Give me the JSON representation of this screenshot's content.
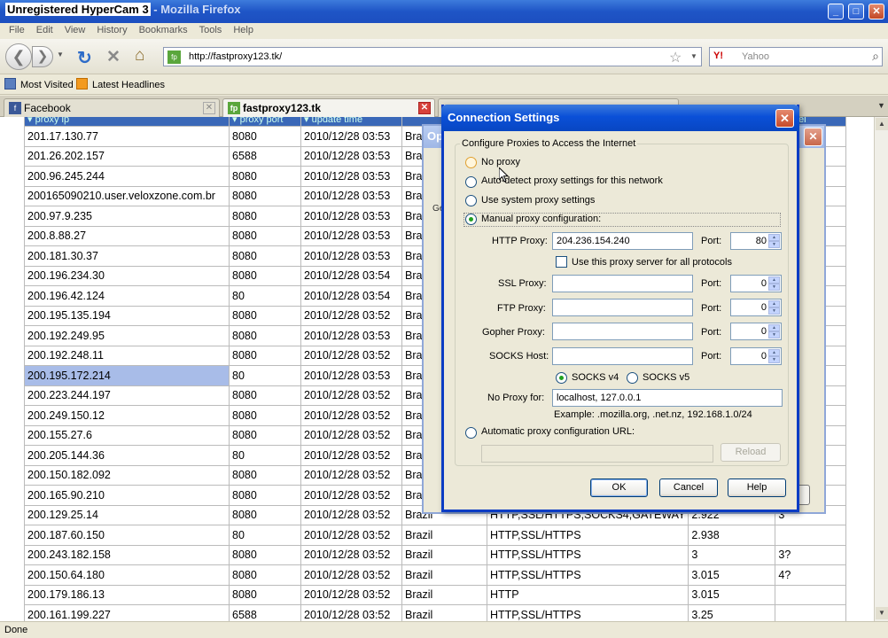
{
  "window": {
    "title_watermark": "Unregistered HyperCam 3",
    "title_rest": " - Mozilla Firefox",
    "controls": [
      "_",
      "□",
      "✕"
    ]
  },
  "menu": [
    "File",
    "Edit",
    "View",
    "History",
    "Bookmarks",
    "Tools",
    "Help"
  ],
  "nav": {
    "url": "http://fastproxy123.tk/",
    "search_engine": "Y!",
    "search_placeholder": "Yahoo"
  },
  "bookmarks": [
    "Most Visited",
    "Latest Headlines"
  ],
  "tabs": [
    {
      "label": "Facebook",
      "active": false
    },
    {
      "label": "fastproxy123.tk",
      "active": true
    },
    {
      "label": "",
      "active": false
    }
  ],
  "table": {
    "headers": [
      "▾ proxy ip",
      "▾ proxy port",
      "▾ update time",
      "",
      "",
      "",
      "▾ level"
    ],
    "rows": [
      [
        "201.17.130.77",
        "8080",
        "2010/12/28 03:53",
        "Brazil",
        "",
        "",
        ""
      ],
      [
        "201.26.202.157",
        "6588",
        "2010/12/28 03:53",
        "Brazil",
        "",
        "",
        ""
      ],
      [
        "200.96.245.244",
        "8080",
        "2010/12/28 03:53",
        "Brazil",
        "",
        "",
        ""
      ],
      [
        "200165090210.user.veloxzone.com.br",
        "8080",
        "2010/12/28 03:53",
        "Brazil",
        "",
        "",
        ""
      ],
      [
        "200.97.9.235",
        "8080",
        "2010/12/28 03:53",
        "Brazil",
        "",
        "",
        ""
      ],
      [
        "200.8.88.27",
        "8080",
        "2010/12/28 03:53",
        "Brazil",
        "",
        "",
        ""
      ],
      [
        "200.181.30.37",
        "8080",
        "2010/12/28 03:53",
        "Brazil",
        "",
        "",
        ""
      ],
      [
        "200.196.234.30",
        "8080",
        "2010/12/28 03:54",
        "Brazil",
        "",
        "",
        ""
      ],
      [
        "200.196.42.124",
        "80",
        "2010/12/28 03:54",
        "Brazil",
        "",
        "",
        ""
      ],
      [
        "200.195.135.194",
        "8080",
        "2010/12/28 03:52",
        "Brazil",
        "",
        "",
        ""
      ],
      [
        "200.192.249.95",
        "8080",
        "2010/12/28 03:53",
        "Brazil",
        "",
        "",
        ""
      ],
      [
        "200.192.248.11",
        "8080",
        "2010/12/28 03:52",
        "Brazil",
        "",
        "",
        ""
      ],
      [
        "200.195.172.214",
        "80",
        "2010/12/28 03:53",
        "Brazil",
        "",
        "",
        ""
      ],
      [
        "200.223.244.197",
        "8080",
        "2010/12/28 03:52",
        "Brazil",
        "",
        "",
        ""
      ],
      [
        "200.249.150.12",
        "8080",
        "2010/12/28 03:52",
        "Brazil",
        "",
        "",
        ""
      ],
      [
        "200.155.27.6",
        "8080",
        "2010/12/28 03:52",
        "Brazil",
        "",
        "",
        ""
      ],
      [
        "200.205.144.36",
        "80",
        "2010/12/28 03:52",
        "Brazil",
        "",
        "",
        ""
      ],
      [
        "200.150.182.092",
        "8080",
        "2010/12/28 03:52",
        "Brazil",
        "",
        "",
        ""
      ],
      [
        "200.165.90.210",
        "8080",
        "2010/12/28 03:52",
        "Brazil",
        "",
        "",
        ""
      ],
      [
        "200.129.25.14",
        "8080",
        "2010/12/28 03:52",
        "Brazil",
        "HTTP,SSL/HTTPS,SOCKS4,GATEWAY",
        "2.922",
        "3"
      ],
      [
        "200.187.60.150",
        "80",
        "2010/12/28 03:52",
        "Brazil",
        "HTTP,SSL/HTTPS",
        "2.938",
        ""
      ],
      [
        "200.243.182.158",
        "8080",
        "2010/12/28 03:52",
        "Brazil",
        "HTTP,SSL/HTTPS",
        "3",
        "3?"
      ],
      [
        "200.150.64.180",
        "8080",
        "2010/12/28 03:52",
        "Brazil",
        "HTTP,SSL/HTTPS",
        "3.015",
        "4?"
      ],
      [
        "200.179.186.13",
        "8080",
        "2010/12/28 03:52",
        "Brazil",
        "HTTP",
        "3.015",
        ""
      ],
      [
        "200.161.199.227",
        "6588",
        "2010/12/28 03:52",
        "Brazil",
        "HTTP,SSL/HTTPS",
        "3.25",
        ""
      ]
    ],
    "selected_row": 12
  },
  "status": "Done",
  "options_dialog": {
    "title": "Op",
    "tab_fragment": "Ge"
  },
  "conn": {
    "title": "Connection Settings",
    "group_label": "Configure Proxies to Access the Internet",
    "opt_no_proxy": "No proxy",
    "opt_auto_detect": "Auto-detect proxy settings for this network",
    "opt_system": "Use system proxy settings",
    "opt_manual": "Manual proxy configuration:",
    "http_label": "HTTP Proxy:",
    "http_value": "204.236.154.240",
    "port_label": "Port:",
    "http_port": "80",
    "same_proxy_label": "Use this proxy server for all protocols",
    "ssl_label": "SSL Proxy:",
    "ssl_port": "0",
    "ftp_label": "FTP Proxy:",
    "ftp_port": "0",
    "gopher_label": "Gopher Proxy:",
    "gopher_port": "0",
    "socks_label": "SOCKS Host:",
    "socks_port": "0",
    "socks_v4": "SOCKS v4",
    "socks_v5": "SOCKS v5",
    "no_proxy_label": "No Proxy for:",
    "no_proxy_value": "localhost, 127.0.0.1",
    "example": "Example: .mozilla.org, .net.nz, 192.168.1.0/24",
    "opt_auto_url": "Automatic proxy configuration URL:",
    "reload": "Reload",
    "ok": "OK",
    "cancel": "Cancel",
    "help": "Help"
  },
  "colors": {
    "titlebar": "#0a50d8",
    "selection": "#a8bce8",
    "radio_dot": "#21a121"
  }
}
